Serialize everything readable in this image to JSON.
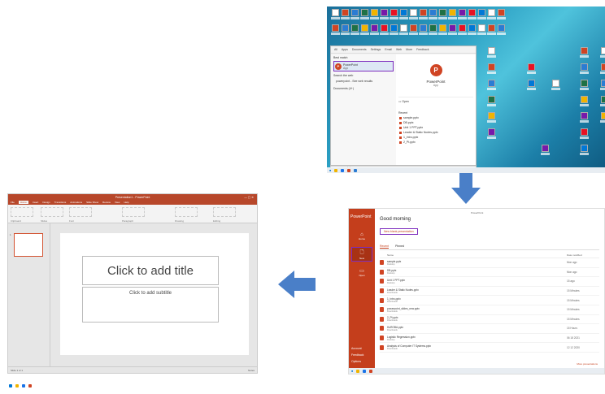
{
  "desktop": {
    "start_tabs": [
      "All",
      "Apps",
      "Documents",
      "Settings",
      "Email",
      "Web",
      "More",
      "Feedback"
    ],
    "best_match_header": "Best match",
    "best_match_name": "PowerPoint",
    "best_match_type": "App",
    "search_web_header": "Search the web",
    "search_web_item": "powerpoint - See web results",
    "documents_header": "Documents (4+)",
    "detail_name": "PowerPoint",
    "detail_type": "App",
    "open_label": "Open",
    "recent_header": "Recent",
    "recent_items": [
      "sample.pptx",
      "DB.pptx",
      "Unit 1 PPT.pptx",
      "Leader & Static Nodes.pptx",
      "1_intro.pptx",
      "2_Pt.pptx"
    ],
    "search_text": "powerpoint"
  },
  "home": {
    "brand": "PowerPoint",
    "greeting": "Good morning",
    "new_presentation": "New blank presentation",
    "window_title": "PowerPoint",
    "tab_recent": "Recent",
    "tab_pinned": "Pinned",
    "col_name": "Name",
    "col_modified": "Date modified",
    "nav": {
      "home": "Home",
      "new": "New",
      "open": "Open"
    },
    "nav_footer": [
      "Account",
      "Feedback",
      "Options"
    ],
    "files": [
      {
        "name": "sample.pptx",
        "sub": "Desktop",
        "date": "Mon ago"
      },
      {
        "name": "DB.pptx",
        "sub": "Desktop",
        "date": "Mon ago"
      },
      {
        "name": "Unit 1 PPT.pptx",
        "sub": "Desktop",
        "date": "15 ago"
      },
      {
        "name": "Leader & Static Nodes.pptx",
        "sub": "Downloads",
        "date": "15 Minutes"
      },
      {
        "name": "1_intro.pptx",
        "sub": "Downloads",
        "date": "15 Minutes"
      },
      {
        "name": "powerpoint_slides_new.pptx",
        "sub": "Downloads",
        "date": "15 Minutes"
      },
      {
        "name": "2_Pt.pptx",
        "sub": "Downloads",
        "date": "15 Minutes"
      },
      {
        "name": "HoROBA.pptx",
        "sub": "Downloads",
        "date": "15 Hours"
      },
      {
        "name": "Logistic Regression.pptx",
        "sub": "Desktop",
        "date": "06 18 2021"
      },
      {
        "name": "Analysis of Computer IT Systems.pptx",
        "sub": "Downloads",
        "date": "12 12 2020"
      }
    ],
    "more_link": "More presentations"
  },
  "editor": {
    "window_title": "Presentation1 - PowerPoint",
    "tabs": [
      "File",
      "Home",
      "Insert",
      "Design",
      "Transitions",
      "Animations",
      "Slide Show",
      "Review",
      "View",
      "Help"
    ],
    "ribbon_groups": [
      "Clipboard",
      "Slides",
      "Font",
      "Paragraph",
      "Drawing",
      "Editing"
    ],
    "slide_number": "1",
    "title_placeholder": "Click to add title",
    "subtitle_placeholder": "Click to add subtitle",
    "status_left": "Slide 1 of 1",
    "status_right": "Notes"
  },
  "colors": {
    "ppt_red": "#c43e1c",
    "highlight_purple": "#7d2dbe",
    "arrow_blue": "#4a7fc8"
  }
}
